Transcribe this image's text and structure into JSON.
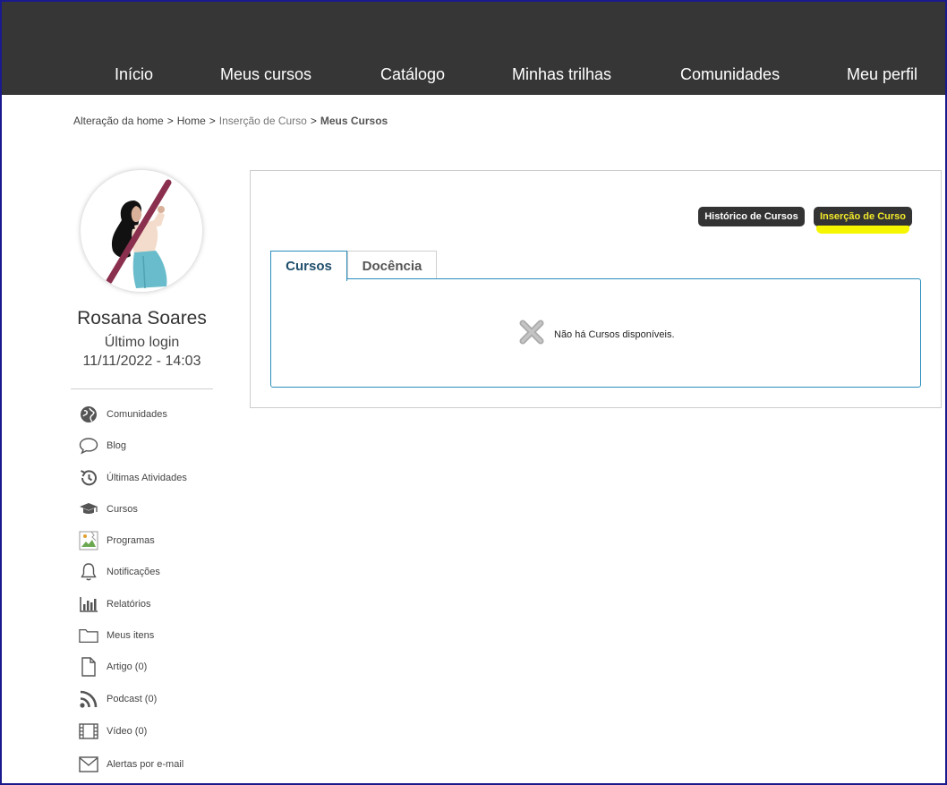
{
  "nav": {
    "items": [
      {
        "label": "Início"
      },
      {
        "label": "Meus cursos"
      },
      {
        "label": "Catálogo"
      },
      {
        "label": "Minhas trilhas"
      },
      {
        "label": "Comunidades"
      },
      {
        "label": "Meu perfil"
      }
    ]
  },
  "breadcrumb": {
    "items": [
      {
        "label": "Alteração da home"
      },
      {
        "label": "Home"
      },
      {
        "label": "Inserção de Curso"
      },
      {
        "label": "Meus Cursos"
      }
    ],
    "separator": ">"
  },
  "profile": {
    "name": "Rosana Soares",
    "last_login_label": "Último login",
    "last_login_date": "11/11/2022 - 14:03"
  },
  "sidebar": {
    "items": [
      {
        "label": "Comunidades",
        "icon": "globe-icon"
      },
      {
        "label": "Blog",
        "icon": "speech-bubble-icon"
      },
      {
        "label": "Últimas Atividades",
        "icon": "history-icon"
      },
      {
        "label": "Cursos",
        "icon": "graduation-cap-icon"
      },
      {
        "label": "Programas",
        "icon": "broken-image-icon"
      },
      {
        "label": "Notificações",
        "icon": "bell-icon"
      },
      {
        "label": "Relatórios",
        "icon": "bar-chart-icon"
      },
      {
        "label": "Meus itens",
        "icon": "folder-icon"
      },
      {
        "label": "Artigo (0)",
        "icon": "document-icon"
      },
      {
        "label": "Podcast (0)",
        "icon": "rss-icon"
      },
      {
        "label": "Vídeo (0)",
        "icon": "film-icon"
      },
      {
        "label": "Alertas por e-mail",
        "icon": "envelope-icon"
      }
    ]
  },
  "actions": {
    "history_label": "Histórico de Cursos",
    "insert_label": "Inserção de Curso"
  },
  "tabs": [
    {
      "label": "Cursos",
      "active": true
    },
    {
      "label": "Docência",
      "active": false
    }
  ],
  "empty_state": {
    "message": "Não há Cursos disponíveis.",
    "icon": "x-icon"
  },
  "colors": {
    "topbar": "#363636",
    "button": "#333333",
    "highlight": "#f6f600",
    "tab_border": "#2a8fbd"
  }
}
